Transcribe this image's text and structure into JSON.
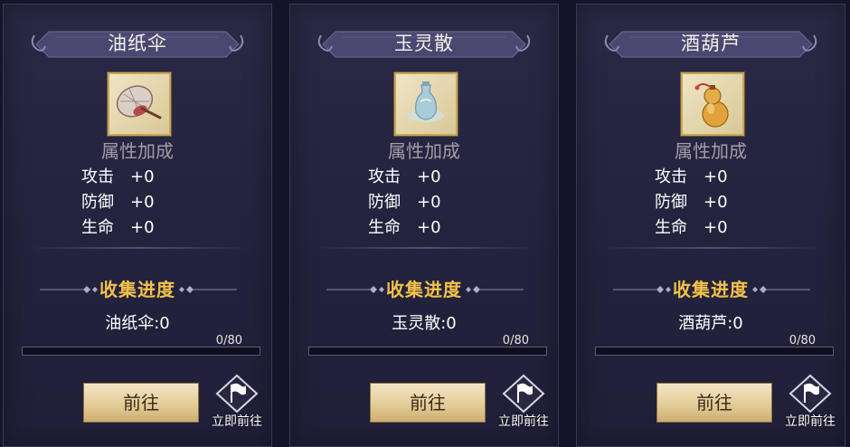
{
  "cards": [
    {
      "title": "油纸伞",
      "item_icon": "oil-paper-umbrella-icon",
      "attr_title": "属性加成",
      "stats": [
        {
          "name": "攻击",
          "value": "+0"
        },
        {
          "name": "防御",
          "value": "+0"
        },
        {
          "name": "生命",
          "value": "+0"
        }
      ],
      "collect_title": "收集进度",
      "collect_count": "油纸伞:0",
      "progress_text": "0/80",
      "progress_fraction": 0,
      "go_label": "前往",
      "quick_go_label": "立即前往"
    },
    {
      "title": "玉灵散",
      "item_icon": "jade-bottle-icon",
      "attr_title": "属性加成",
      "stats": [
        {
          "name": "攻击",
          "value": "+0"
        },
        {
          "name": "防御",
          "value": "+0"
        },
        {
          "name": "生命",
          "value": "+0"
        }
      ],
      "collect_title": "收集进度",
      "collect_count": "玉灵散:0",
      "progress_text": "0/80",
      "progress_fraction": 0,
      "go_label": "前往",
      "quick_go_label": "立即前往"
    },
    {
      "title": "酒葫芦",
      "item_icon": "wine-gourd-icon",
      "attr_title": "属性加成",
      "stats": [
        {
          "name": "攻击",
          "value": "+0"
        },
        {
          "name": "防御",
          "value": "+0"
        },
        {
          "name": "生命",
          "value": "+0"
        }
      ],
      "collect_title": "收集进度",
      "collect_count": "酒葫芦:0",
      "progress_text": "0/80",
      "progress_fraction": 0,
      "go_label": "前往",
      "quick_go_label": "立即前往"
    }
  ],
  "colors": {
    "accent_gold": "#f3c24a",
    "attr_title": "#a79aa8",
    "progress_fill": "#d8a640"
  }
}
